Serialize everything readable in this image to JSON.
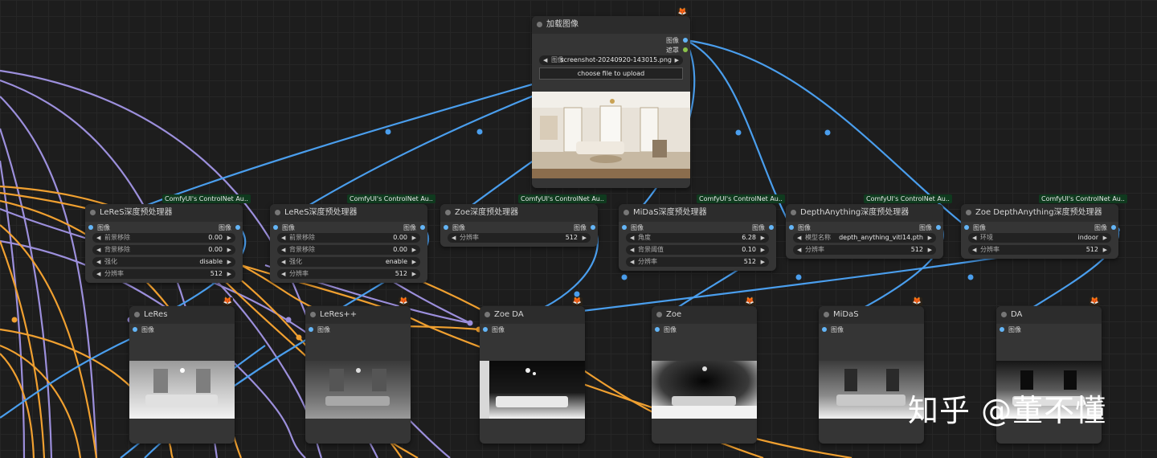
{
  "load_node": {
    "title": "加载图像",
    "outputs": [
      "图像",
      "遮罩"
    ],
    "image_label": "图像",
    "image_value": "screenshot-20240920-143015.png",
    "upload_label": "choose file to upload"
  },
  "badge_text": "ComfyUI's ControlNet Au..",
  "preprocessors": [
    {
      "title": "LeReS深度预处理器",
      "input": "图像",
      "output": "图像",
      "widgets": [
        {
          "label": "前景移除",
          "value": "0.00"
        },
        {
          "label": "背景移除",
          "value": "0.00"
        },
        {
          "label": "强化",
          "value": "disable"
        },
        {
          "label": "分辨率",
          "value": "512"
        }
      ]
    },
    {
      "title": "LeReS深度预处理器",
      "input": "图像",
      "output": "图像",
      "widgets": [
        {
          "label": "前景移除",
          "value": "0.00"
        },
        {
          "label": "背景移除",
          "value": "0.00"
        },
        {
          "label": "强化",
          "value": "enable"
        },
        {
          "label": "分辨率",
          "value": "512"
        }
      ]
    },
    {
      "title": "Zoe深度预处理器",
      "input": "图像",
      "output": "图像",
      "widgets": [
        {
          "label": "分辨率",
          "value": "512"
        }
      ]
    },
    {
      "title": "MiDaS深度预处理器",
      "input": "图像",
      "output": "图像",
      "widgets": [
        {
          "label": "角度",
          "value": "6.28"
        },
        {
          "label": "背景阈值",
          "value": "0.10"
        },
        {
          "label": "分辨率",
          "value": "512"
        }
      ]
    },
    {
      "title": "DepthAnything深度预处理器",
      "input": "图像",
      "output": "图像",
      "widgets": [
        {
          "label": "模型名称",
          "value": "depth_anything_vitl14.pth"
        },
        {
          "label": "分辨率",
          "value": "512"
        }
      ]
    },
    {
      "title": "Zoe DepthAnything深度预处理器",
      "input": "图像",
      "output": "图像",
      "widgets": [
        {
          "label": "环境",
          "value": "indoor"
        },
        {
          "label": "分辨率",
          "value": "512"
        }
      ]
    }
  ],
  "previews": [
    {
      "title": "LeRes",
      "input": "图像"
    },
    {
      "title": "LeRes++",
      "input": "图像"
    },
    {
      "title": "Zoe DA",
      "input": "图像"
    },
    {
      "title": "Zoe",
      "input": "图像"
    },
    {
      "title": "MiDaS",
      "input": "图像"
    },
    {
      "title": "DA",
      "input": "图像"
    }
  ],
  "watermark": "知乎 @董不懂",
  "colors": {
    "link_blue": "#4a9eed",
    "link_purple": "#9c8fdc",
    "link_orange": "#f0a030",
    "node_bg": "#353535",
    "badge_bg": "#0f3a1e"
  },
  "icons": [
    "fox-icon",
    "arrow-left-icon",
    "arrow-right-icon",
    "socket-dot-icon"
  ]
}
